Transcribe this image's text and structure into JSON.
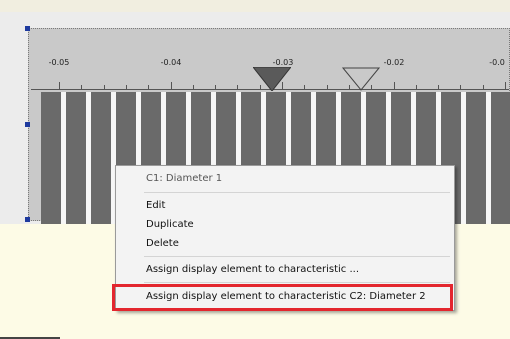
{
  "scale": {
    "tick_labels": [
      "-0.05",
      "-0.04",
      "-0.03",
      "-0.02",
      "-0.0"
    ],
    "markers": [
      {
        "name": "filled-triangle",
        "style": "filled"
      },
      {
        "name": "outline-triangle",
        "style": "outline"
      }
    ],
    "bar_count": 19
  },
  "context_menu": {
    "header": "C1: Diameter 1",
    "items": [
      {
        "label": "Edit"
      },
      {
        "label": "Duplicate"
      },
      {
        "label": "Delete"
      },
      {
        "label": "Assign display element to characteristic ..."
      },
      {
        "label": "Assign display element to characteristic C2: Diameter 2"
      }
    ]
  },
  "colors": {
    "highlight": "#e3262e",
    "bar": "#6a6a6a",
    "selection_handle": "#1e3a9e"
  }
}
